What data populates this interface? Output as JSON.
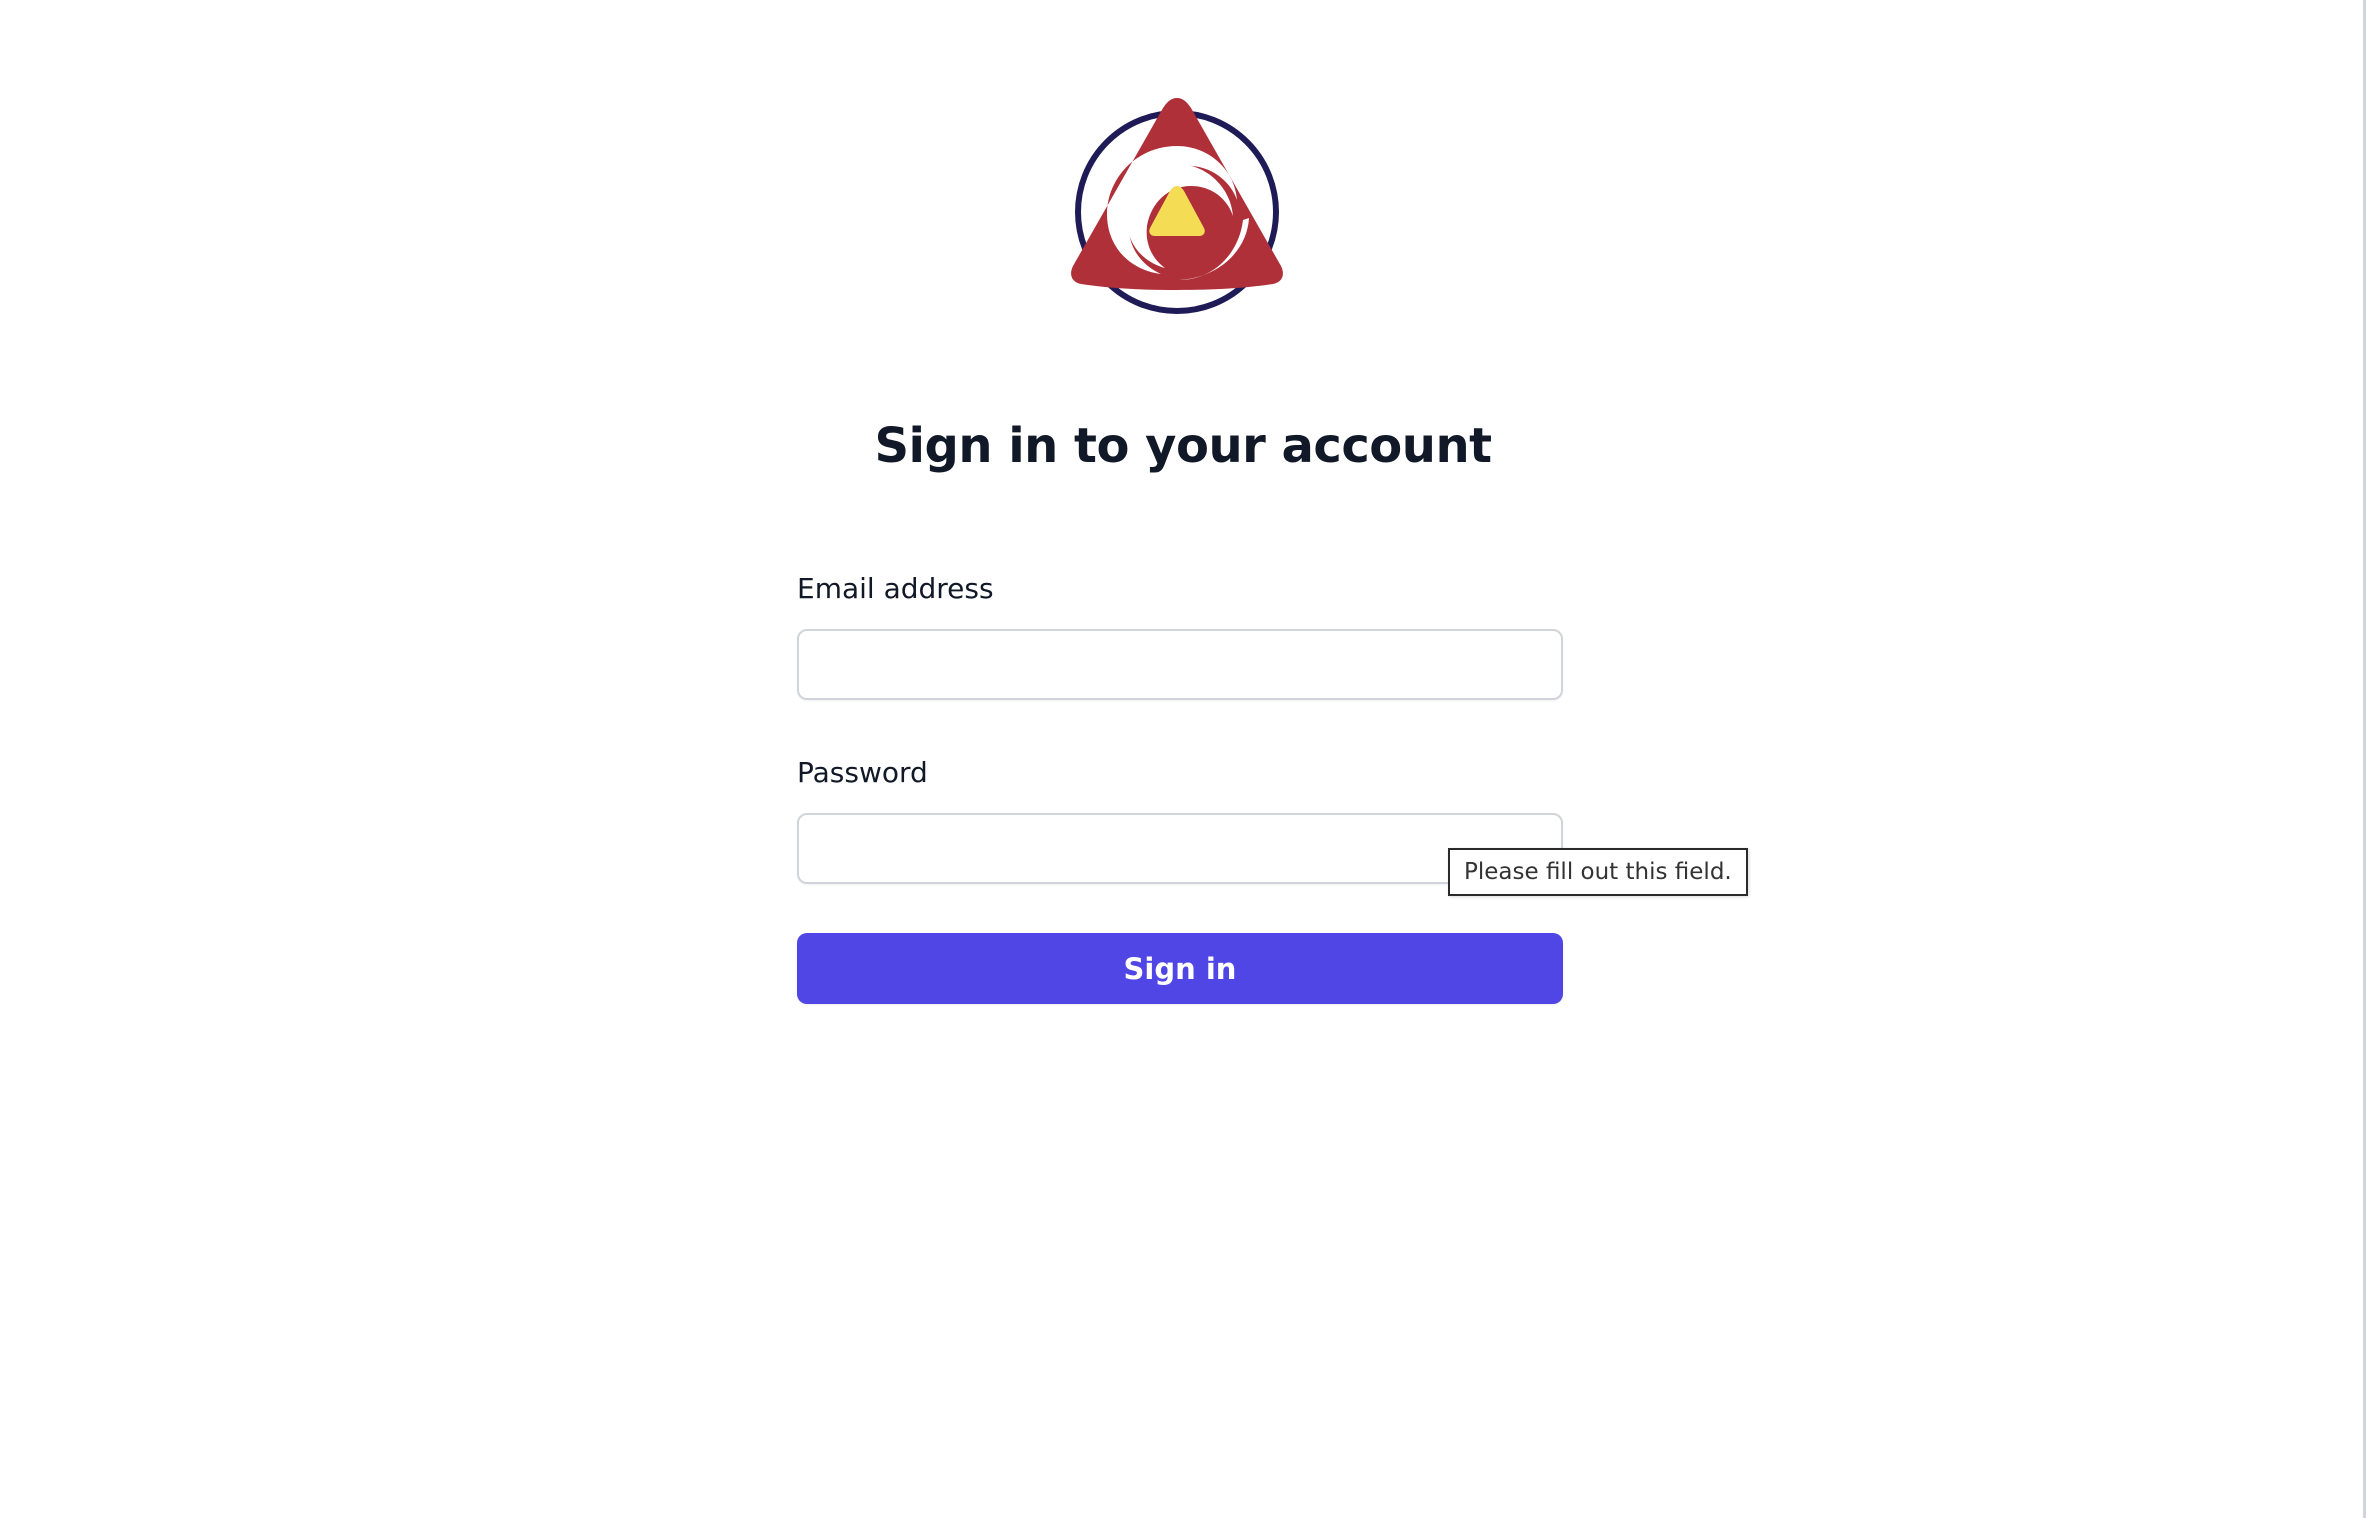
{
  "brand": {
    "logo_icon": "triple-swirl-logo",
    "colors": {
      "red": "#b0303a",
      "navy": "#1f1b57",
      "yellow": "#f5dc55"
    }
  },
  "form": {
    "title": "Sign in to your account",
    "email_label": "Email address",
    "email_value": "",
    "password_label": "Password",
    "password_value": "",
    "submit_label": "Sign in"
  },
  "validation": {
    "tooltip": "Please fill out this field."
  },
  "theme": {
    "accent": "#4f46e5",
    "input_border": "#d1d5db",
    "text": "#111827"
  }
}
